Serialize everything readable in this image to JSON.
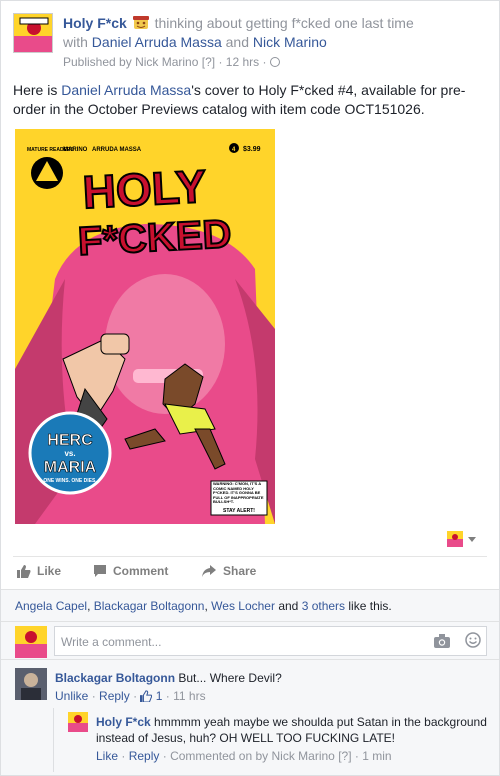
{
  "post": {
    "page_name": "Holy F*ck",
    "feeling_text": "thinking about getting f*cked one last time",
    "with_prefix": "with",
    "with_people": [
      "Daniel Arruda Massa",
      "Nick Marino"
    ],
    "and_word": "and",
    "published_by_prefix": "Published by",
    "publisher": "Nick Marino",
    "publisher_badge": "[?]",
    "time": "12 hrs",
    "text_prefix": "Here is",
    "text_link": "Daniel Arruda Massa",
    "text_suffix": "'s cover to Holy F*cked #4, available for pre-order in the October Previews catalog with item code OCT151026."
  },
  "cover": {
    "mature": "MATURE READERS",
    "author1": "MARINO",
    "author2": "ARRUDA MASSA",
    "issue": "4",
    "price": "$3.99",
    "title_line1": "HOLY",
    "title_line2": "F*CKED",
    "badge_line1": "HERC",
    "badge_line2": "vs.",
    "badge_line3": "MARIA",
    "badge_tagline": "ONE WINS. ONE DIES.",
    "warning_text": "WARNING: C'MON, IT'S A COMIC NAMED HOLY F*CKED. IT'S GONNA BE FULL OF INAPPROPRIATE BULLSH*T.",
    "warning_footer": "STAY ALERT!",
    "colors": {
      "background": "#ffd42a",
      "pink": "#e94b8a",
      "red": "#c8102e"
    }
  },
  "actions": {
    "like": "Like",
    "comment": "Comment",
    "share": "Share"
  },
  "likes": {
    "names": [
      "Angela Capel",
      "Blackagar Boltagonn",
      "Wes Locher"
    ],
    "and_word": "and",
    "others": "3 others",
    "suffix": "like this."
  },
  "compose": {
    "placeholder": "Write a comment..."
  },
  "comments": [
    {
      "author": "Blackagar Boltagonn",
      "text": "But... Where Devil?",
      "actions": [
        "Unlike",
        "Reply"
      ],
      "likes": "1",
      "time": "11 hrs"
    }
  ],
  "reply": {
    "author": "Holy F*ck",
    "text": "hmmmm yeah maybe we shoulda put Satan in the background instead of Jesus, huh? OH WELL TOO FUCKING LATE!",
    "actions": [
      "Like",
      "Reply"
    ],
    "commented_on_by": "Commented on by",
    "commenter": "Nick Marino",
    "badge": "[?]",
    "time": "1 min"
  }
}
